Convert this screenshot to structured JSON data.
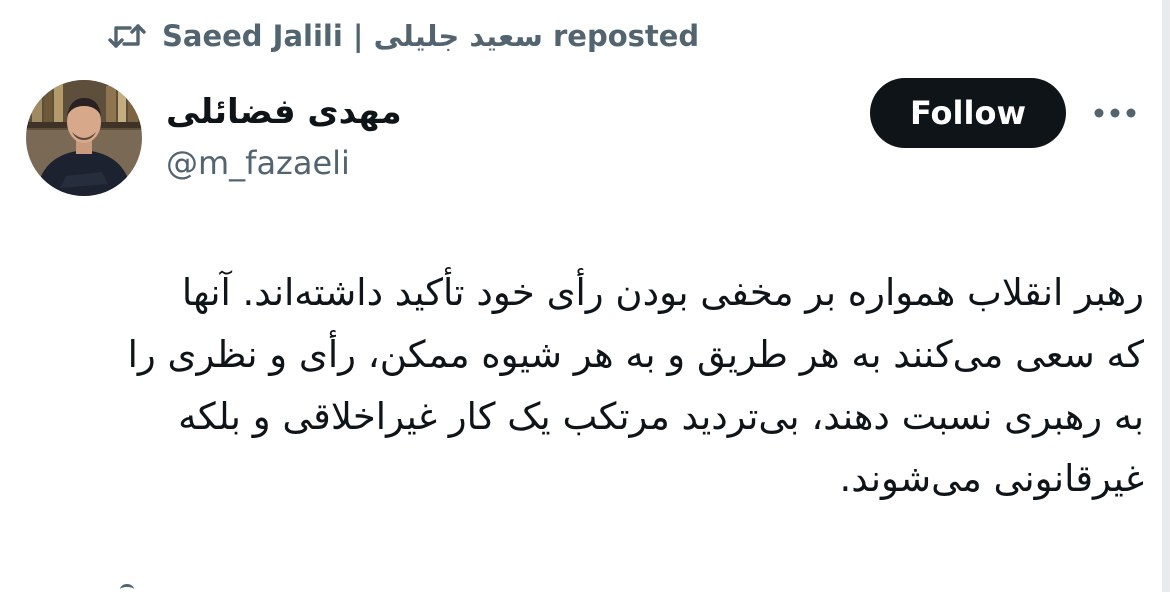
{
  "repost": {
    "icon": "repost-icon",
    "text": "Saeed Jalili | سعید جلیلی reposted"
  },
  "author": {
    "avatar_icon": "avatar",
    "display_name": "مهدی فضائلی",
    "handle": "@m_fazaeli"
  },
  "actions": {
    "follow_label": "Follow",
    "more_icon": "more-dots-icon"
  },
  "tweet": {
    "lines": [
      "رهبر انقلاب همواره بر مخفی بودن رأی خود تأکید داشته‌اند. آنها",
      "که سعی می‌کنند به هر طریق و به هر شیوه ممکن، رأی و نظری را",
      "به رهبری نسبت دهند، بی‌تردید مرتکب یک کار غیراخلاقی و بلکه",
      "غیرقانونی می‌شوند."
    ]
  },
  "colors": {
    "text_primary": "#0f1419",
    "text_secondary": "#536471",
    "follow_bg": "#0f1419",
    "follow_text": "#ffffff",
    "background": "#ffffff"
  }
}
